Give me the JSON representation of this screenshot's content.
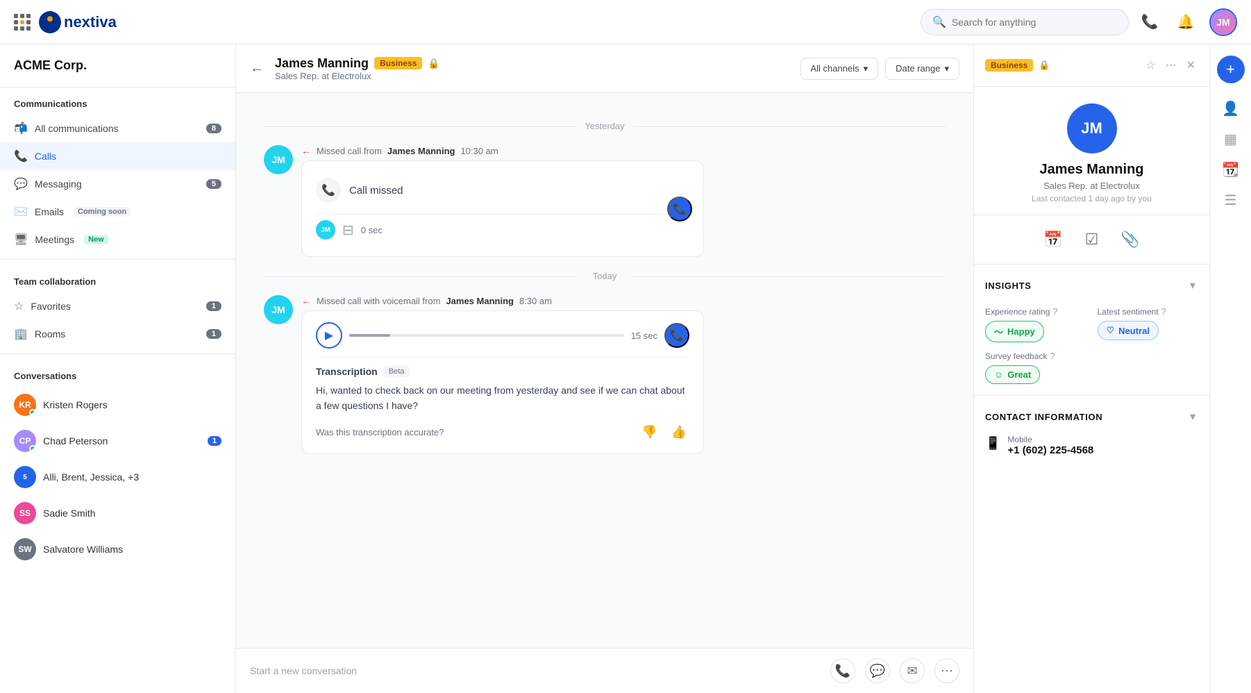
{
  "app": {
    "name": "Nextiva",
    "logo_text": "nextiva"
  },
  "topnav": {
    "search_placeholder": "Search for anything",
    "user_initials": "JM"
  },
  "sidebar": {
    "company": "ACME Corp.",
    "sections": [
      {
        "title": "Communications",
        "items": [
          {
            "id": "all-comms",
            "label": "All communications",
            "badge": "8",
            "icon": "✉"
          },
          {
            "id": "calls",
            "label": "Calls",
            "badge": "",
            "icon": "📞",
            "active": true
          },
          {
            "id": "messaging",
            "label": "Messaging",
            "badge": "5",
            "icon": "💬"
          },
          {
            "id": "emails",
            "label": "Emails",
            "tag": "Coming soon",
            "icon": "✉"
          },
          {
            "id": "meetings",
            "label": "Meetings",
            "tag": "New",
            "icon": "🖥"
          }
        ]
      },
      {
        "title": "Team collaboration",
        "items": [
          {
            "id": "favorites",
            "label": "Favorites",
            "badge": "1",
            "icon": "☆"
          },
          {
            "id": "rooms",
            "label": "Rooms",
            "badge": "1",
            "icon": "🏢"
          }
        ]
      }
    ],
    "conversations_label": "Conversations",
    "conversations": [
      {
        "name": "Kristen Rogers",
        "initials": "KR",
        "color": "#f97316",
        "online": true
      },
      {
        "name": "Chad Peterson",
        "initials": "CP",
        "color": "#a78bfa",
        "badge": "1",
        "online": true
      },
      {
        "name": "Alli, Brent, Jessica, +3",
        "initials": "5",
        "color": "#2563eb"
      },
      {
        "name": "Sadie Smith",
        "initials": "SS",
        "color": "#ec4899",
        "online": false
      },
      {
        "name": "Salvatore Williams",
        "initials": "SW",
        "color": "#6b7280"
      }
    ]
  },
  "conversation": {
    "contact_name": "James Manning",
    "contact_badge": "Business",
    "contact_role": "Sales Rep. at Electrolux",
    "filter_channels": "All channels",
    "filter_date": "Date range",
    "yesterday_label": "Yesterday",
    "today_label": "Today",
    "missed_call_1": {
      "from_label": "Missed call from",
      "caller": "James Manning",
      "time": "10:30 am",
      "call_missed_label": "Call missed",
      "duration": "0 sec"
    },
    "missed_call_2": {
      "from_label": "Missed call with voicemail from",
      "caller": "James Manning",
      "time": "8:30 am",
      "audio_duration": "15 sec",
      "transcription_label": "Transcription",
      "beta_tag": "Beta",
      "transcription_text": "Hi, wanted to check back on our meeting from yesterday and see if we can chat about a few questions I have?",
      "accuracy_q": "Was this transcription accurate?"
    },
    "new_conv_placeholder": "Start a new conversation"
  },
  "right_panel": {
    "business_tag": "Business",
    "avatar_initials": "JM",
    "name": "James Manning",
    "role": "Sales Rep. at Electrolux",
    "last_contacted": "Last contacted 1 day ago by you",
    "insights": {
      "title": "INSIGHTS",
      "experience_label": "Experience rating",
      "sentiment_label": "Latest sentiment",
      "experience_value": "Happy",
      "sentiment_value": "Neutral",
      "survey_label": "Survey feedback",
      "survey_value": "Great"
    },
    "contact_info": {
      "title": "CONTACT INFORMATION",
      "mobile_label": "Mobile",
      "mobile_number": "+1 (602) 225-4568"
    }
  }
}
